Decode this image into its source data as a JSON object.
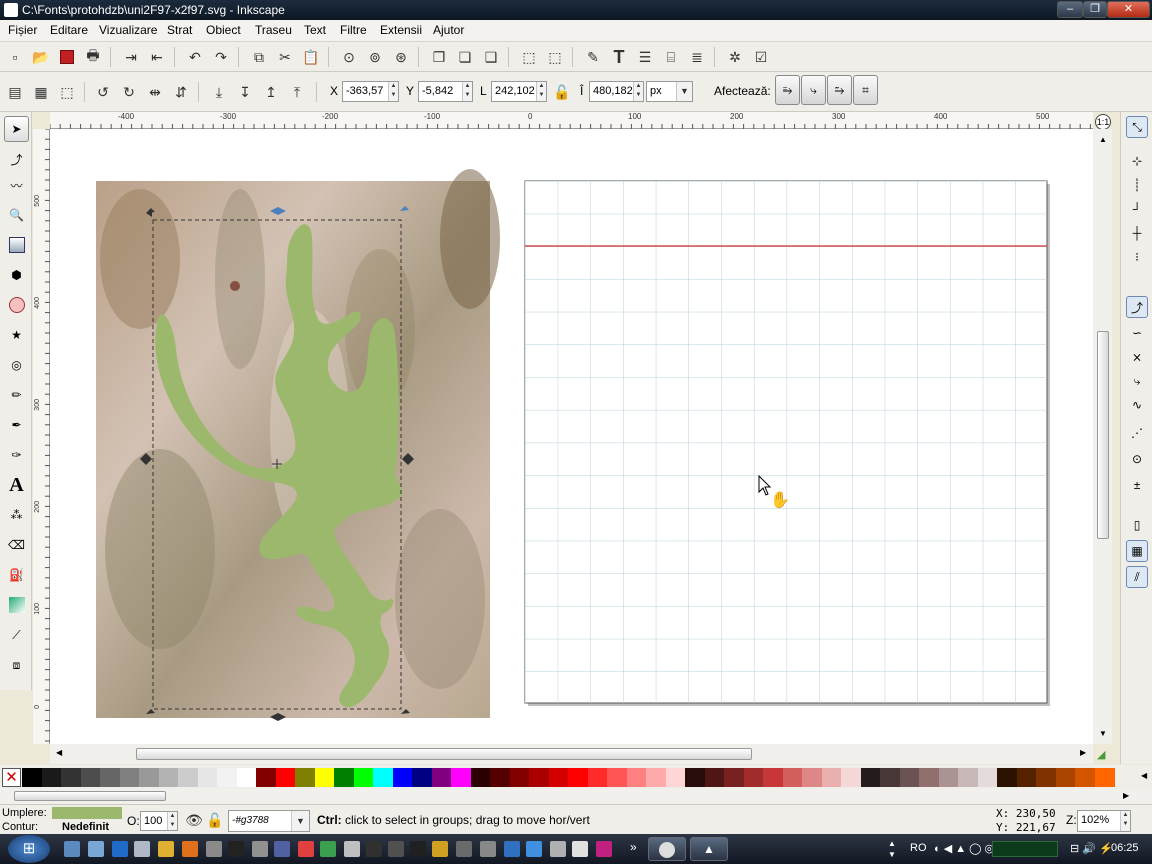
{
  "window": {
    "title": "C:\\Fonts\\protohdzb\\uni2F97-x2f97.svg - Inkscape",
    "app_icon": "inkscape-icon"
  },
  "menu": [
    "Fișier",
    "Editare",
    "Vizualizare",
    "Strat",
    "Obiect",
    "Traseu",
    "Text",
    "Filtre",
    "Extensii",
    "Ajutor"
  ],
  "controls": {
    "x_label": "X",
    "x_value": "-363,57",
    "y_label": "Y",
    "y_value": "-5,842",
    "w_label": "L",
    "w_value": "242,102",
    "h_label": "Î",
    "h_value": "480,182",
    "unit": "px",
    "affect_label": "Afectează:"
  },
  "rulers": {
    "h_ticks": [
      "-400",
      "-300",
      "-200",
      "-100",
      "0",
      "100",
      "200",
      "300",
      "400",
      "500"
    ],
    "v_ticks": [
      "500",
      "400",
      "300",
      "200",
      "100",
      "0"
    ]
  },
  "status": {
    "fill_label": "Umplere:",
    "stroke_label": "Contur:",
    "stroke_value": "Nedefinit",
    "fill_color": "#9cb86c",
    "opacity_label": "O:",
    "opacity_value": "100",
    "layer_value": "-#g3788",
    "message_key": "Ctrl:",
    "message_text": " click to select in groups; drag to move hor/vert",
    "x_coord": "X:  230,50",
    "y_coord": "Y:  221,67",
    "zoom_label": "Z:",
    "zoom_value": "102%"
  },
  "taskbar": {
    "lang": "RO",
    "clock": "06:25"
  },
  "palette": [
    "#000000",
    "#1a1a1a",
    "#333333",
    "#4d4d4d",
    "#666666",
    "#808080",
    "#999999",
    "#b3b3b3",
    "#cccccc",
    "#e6e6e6",
    "#f2f2f2",
    "#ffffff",
    "#800000",
    "#ff0000",
    "#808000",
    "#ffff00",
    "#008000",
    "#00ff00",
    "#00ffff",
    "#0000ff",
    "#000080",
    "#800080",
    "#ff00ff",
    "#2b0000",
    "#550000",
    "#800000",
    "#aa0000",
    "#d40000",
    "#ff0000",
    "#ff2a2a",
    "#ff5555",
    "#ff8080",
    "#ffaaaa",
    "#ffd5d5",
    "#280b0b",
    "#501616",
    "#782121",
    "#a02c2c",
    "#c83737",
    "#d35f5f",
    "#de8787",
    "#e9afaf",
    "#f4d7d7",
    "#241c1c",
    "#483737",
    "#6c5353",
    "#916f6f",
    "#ac9393",
    "#c8b7b7",
    "#e3dbdb",
    "#2b1100",
    "#552200",
    "#803300",
    "#aa4400",
    "#d45500",
    "#ff6600"
  ],
  "colors": {
    "glyph": "#9cb86c",
    "grid": "#b6d2dc",
    "guide": "#d13030"
  }
}
